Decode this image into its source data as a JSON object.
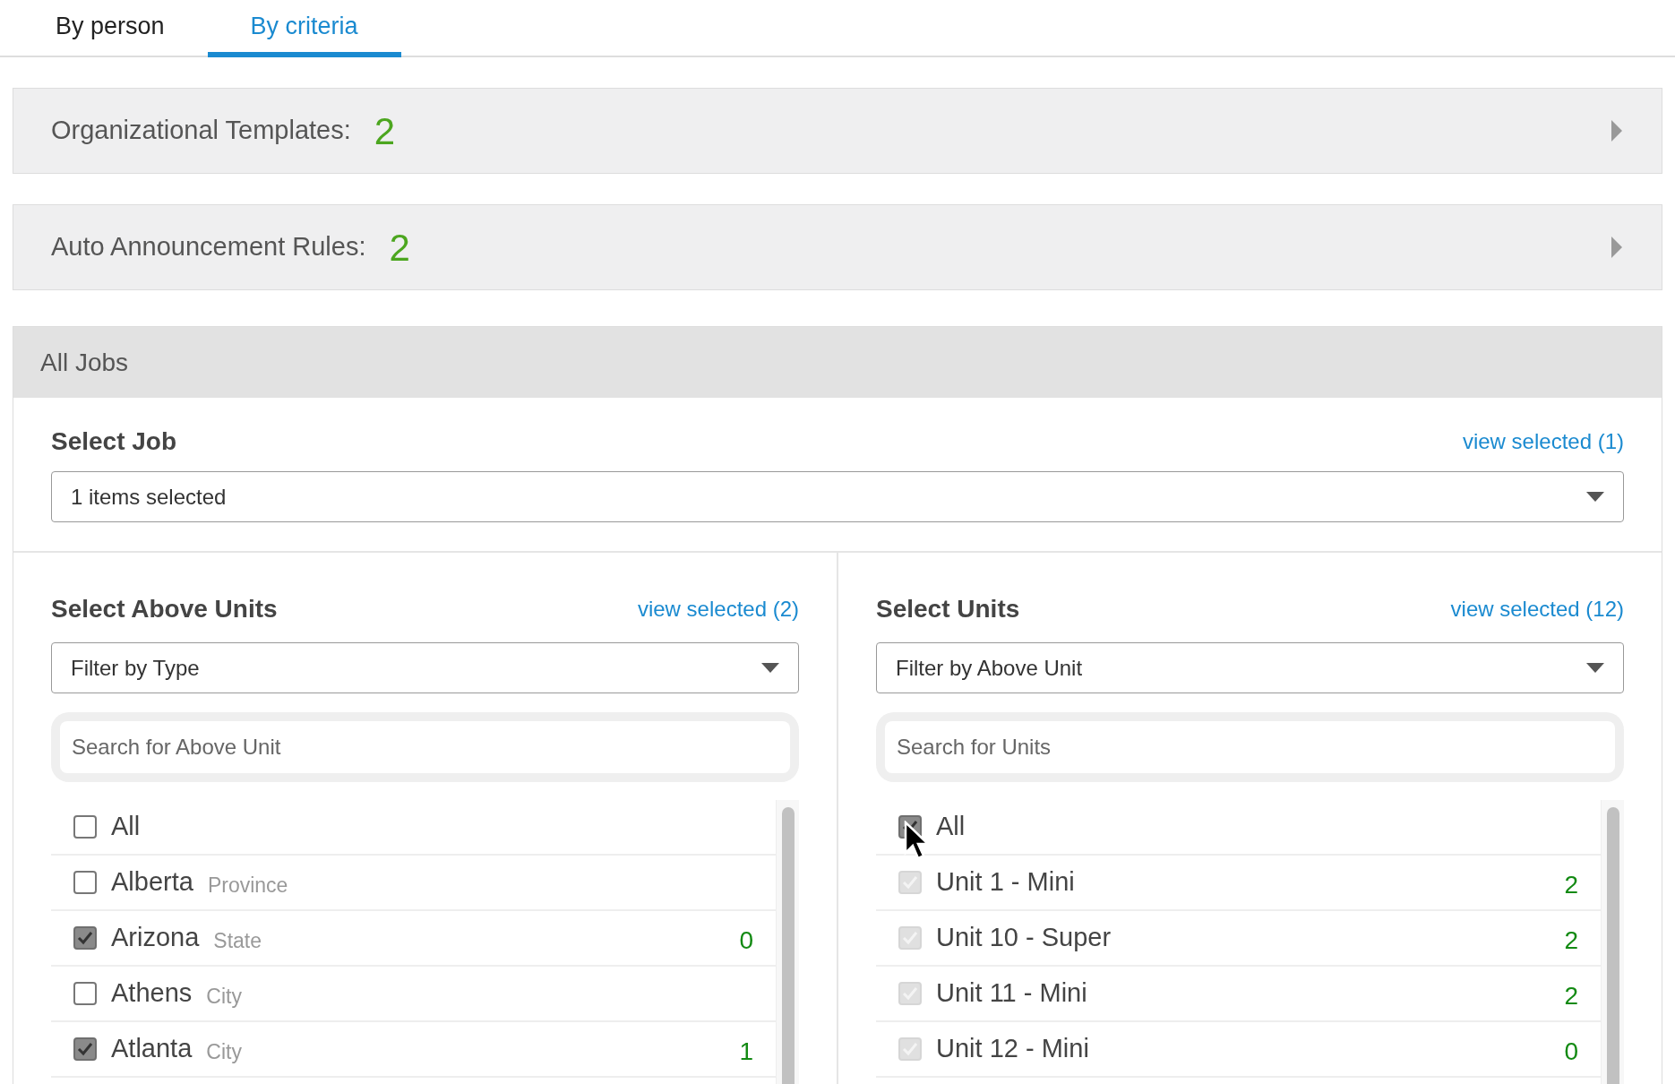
{
  "tabs": [
    {
      "label": "By person",
      "selected": false
    },
    {
      "label": "By criteria",
      "selected": true
    }
  ],
  "summaries": [
    {
      "label": "Organizational Templates:",
      "count": "2",
      "expanded": false
    },
    {
      "label": "Auto Announcement Rules:",
      "count": "2",
      "expanded": false
    }
  ],
  "jobs_panel": {
    "title": "All Jobs",
    "select_job": {
      "label": "Select Job",
      "link": "view selected (1)",
      "value": "1 items selected"
    },
    "columns": [
      {
        "label": "Select Above Units",
        "link": "view selected (2)",
        "filter": "Filter by Type",
        "search_placeholder": "Search for Above Unit",
        "items": [
          {
            "name": "All",
            "checked": false,
            "disabled": false
          },
          {
            "name": "Alberta",
            "type": "Province",
            "checked": false,
            "disabled": false
          },
          {
            "name": "Arizona",
            "type": "State",
            "count": "0",
            "checked": true,
            "disabled": false
          },
          {
            "name": "Athens",
            "type": "City",
            "checked": false,
            "disabled": false
          },
          {
            "name": "Atlanta",
            "type": "City",
            "count": "1",
            "checked": true,
            "disabled": false
          }
        ]
      },
      {
        "label": "Select Units",
        "link": "view selected (12)",
        "filter": "Filter by Above Unit",
        "search_placeholder": "Search for Units",
        "items": [
          {
            "name": "All",
            "checked": true,
            "disabled": false,
            "hovered": true
          },
          {
            "name": "Unit 1 - Mini",
            "count": "2",
            "checked": true,
            "disabled": true
          },
          {
            "name": "Unit 10 - Super",
            "count": "2",
            "checked": true,
            "disabled": true
          },
          {
            "name": "Unit 11 - Mini",
            "count": "2",
            "checked": true,
            "disabled": true
          },
          {
            "name": "Unit 12 - Mini",
            "count": "0",
            "checked": true,
            "disabled": true
          }
        ]
      }
    ]
  }
}
